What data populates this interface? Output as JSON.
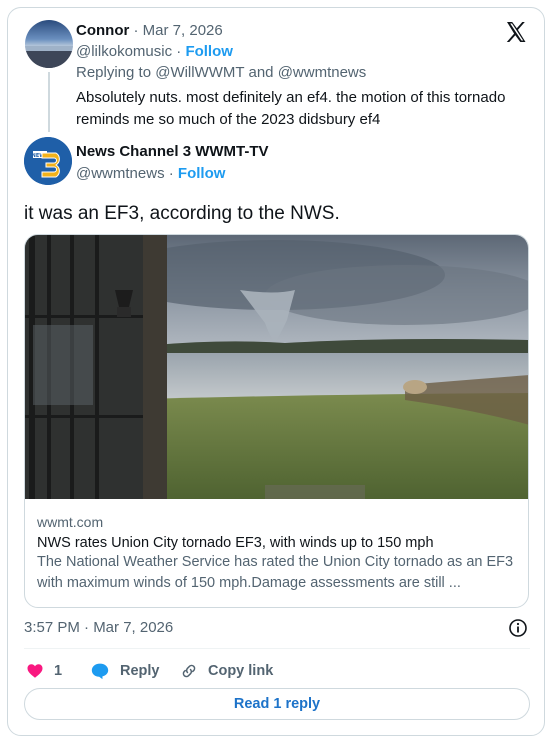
{
  "reply_tweet": {
    "display_name": "Connor",
    "date": "Mar 7, 2026",
    "handle": "@lilkokomusic",
    "follow_label": "Follow",
    "replying_prefix": "Replying to",
    "replying_user1": "@WillWWMT",
    "replying_and": "and",
    "replying_user2": "@wwmtnews",
    "text": "Absolutely nuts. most definitely an ef4. the motion of this tornado reminds me so much of the 2023 didsbury ef4"
  },
  "main_tweet": {
    "display_name": "News Channel 3 WWMT-TV",
    "handle": "@wwmtnews",
    "follow_label": "Follow",
    "text": "it was an EF3, according to the NWS.",
    "link_card": {
      "domain": "wwmt.com",
      "title": "NWS rates Union City tornado EF3, with winds up to 150 mph",
      "description": "The National Weather Service has rated the Union City tornado as an EF3 with maximum winds of 150 mph.Damage assessments are still ..."
    },
    "timestamp": "3:57 PM · Mar 7, 2026"
  },
  "actions": {
    "like_count": "1",
    "reply_label": "Reply",
    "copy_link_label": "Copy link",
    "read_replies_label": "Read 1 reply"
  },
  "icons": {
    "brand": "x-logo-icon",
    "info": "info-icon",
    "like": "heart-icon",
    "reply": "speech-bubble-icon",
    "copy": "link-icon"
  },
  "colors": {
    "accent": "#1d9bf0",
    "like": "#f91880",
    "muted": "#536471",
    "border": "#cfd9de"
  }
}
